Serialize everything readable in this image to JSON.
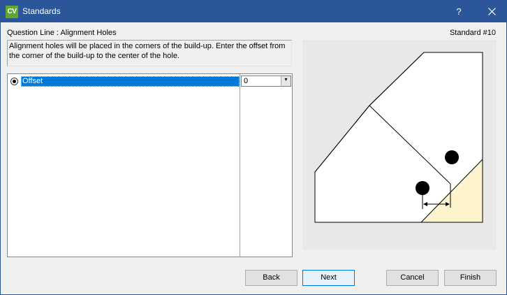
{
  "window": {
    "app_icon_text": "CV",
    "title": "Standards",
    "help_label": "?",
    "close_icon": "close-icon"
  },
  "header": {
    "question_line": "Question Line : Alignment Holes",
    "standard_number": "Standard #10"
  },
  "description": "Alignment holes will be placed in the corners of the build-up. Enter the offset from the corner of the build-up to the center of the hole.",
  "options": [
    {
      "label": "Offset",
      "value": "0",
      "selected": true
    }
  ],
  "illustration": {
    "icon": "alignment-holes-diagram",
    "highlight_color": "#fdf3cc"
  },
  "buttons": {
    "back": "Back",
    "next": "Next",
    "cancel": "Cancel",
    "finish": "Finish"
  },
  "colors": {
    "titlebar": "#2b579a",
    "selection": "#0078d7",
    "app_icon": "#5ea82f"
  }
}
